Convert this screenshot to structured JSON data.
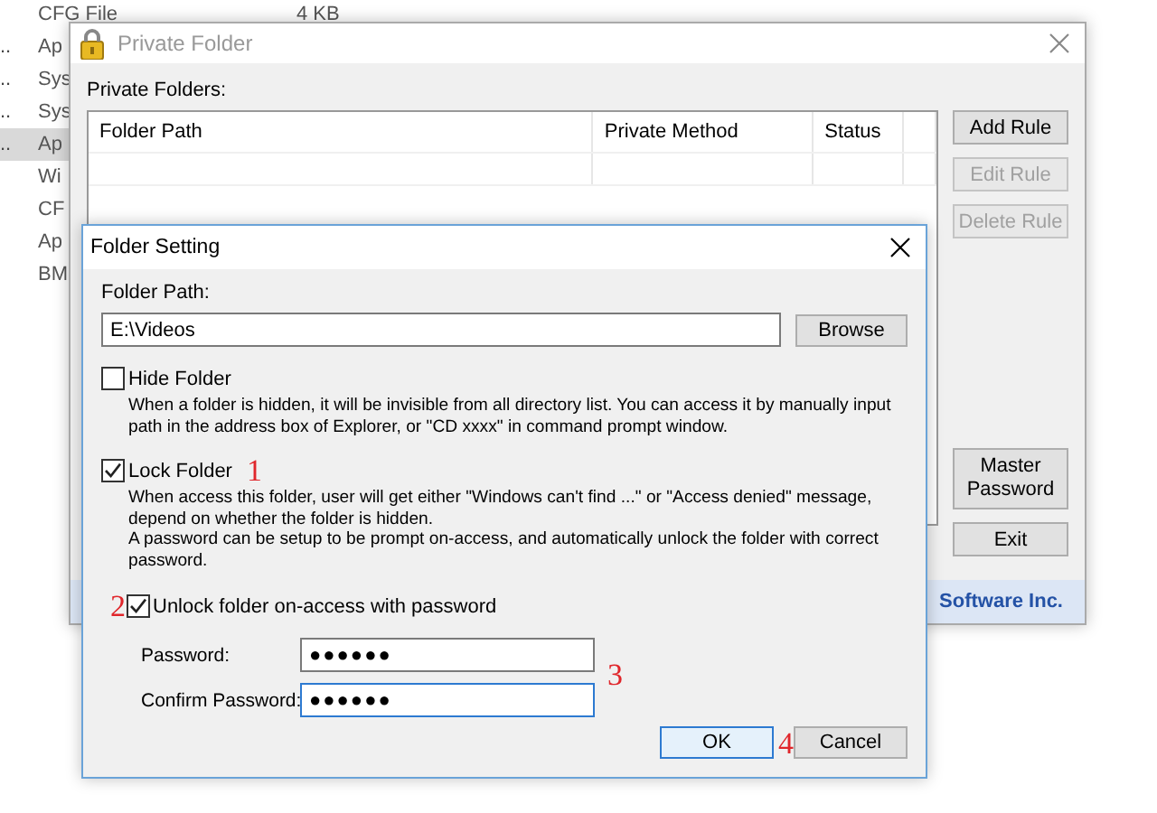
{
  "background_list": {
    "rows": [
      {
        "marker": "",
        "name": "CFG File",
        "size": "4 KB",
        "selected": false
      },
      {
        "marker": "..",
        "name": "Ap",
        "selected": false
      },
      {
        "marker": "..",
        "name": "Sys",
        "selected": false
      },
      {
        "marker": "..",
        "name": "Sys",
        "selected": false
      },
      {
        "marker": "..",
        "name": "Ap",
        "selected": true
      },
      {
        "marker": "",
        "name": "Wi",
        "selected": false
      },
      {
        "marker": "",
        "name": "CF",
        "selected": false
      },
      {
        "marker": "",
        "name": "Ap",
        "selected": false
      },
      {
        "marker": "",
        "name": "BM",
        "selected": false
      }
    ]
  },
  "private_folder_window": {
    "title": "Private Folder",
    "active": false,
    "list_label": "Private Folders:",
    "columns": [
      "Folder Path",
      "Private Method",
      "Status"
    ],
    "buttons": [
      {
        "label": "Add Rule",
        "disabled": false
      },
      {
        "label": "Edit Rule",
        "disabled": true
      },
      {
        "label": "Delete Rule",
        "disabled": true
      }
    ],
    "bottom_buttons": [
      {
        "label": "Master Password",
        "disabled": false
      },
      {
        "label": "Exit",
        "disabled": false
      }
    ],
    "footer": "Software Inc."
  },
  "folder_setting_dialog": {
    "title": "Folder Setting",
    "path_label": "Folder Path:",
    "path_value": "E:\\Videos",
    "browse_button": "Browse",
    "options": [
      {
        "label": "Hide Folder",
        "checked": false,
        "description": [
          "When a folder is hidden, it will be invisible from all directory list. You can access it by manually input",
          "path in the address box of Explorer, or \"CD xxxx\" in command prompt window."
        ]
      },
      {
        "label": "Lock Folder",
        "checked": true,
        "annotation": "1",
        "description": [
          "When access this folder, user will get either \"Windows can't find ...\" or \"Access denied\" message,",
          "depend on whether the folder is hidden.",
          "A password can be setup to be prompt on-access, and automatically unlock the folder with correct",
          "password."
        ]
      },
      {
        "label": "Unlock folder on-access with password",
        "checked": true,
        "annotation": "2"
      }
    ],
    "password_fields": [
      {
        "label": "Password:",
        "value": "●●●●●●",
        "focused": false
      },
      {
        "label": "Confirm Password:",
        "value": "●●●●●●",
        "focused": true
      }
    ],
    "password_annotation": "3",
    "buttons": [
      {
        "label": "OK",
        "default": true,
        "annotation": "4"
      },
      {
        "label": "Cancel",
        "default": false
      }
    ]
  }
}
